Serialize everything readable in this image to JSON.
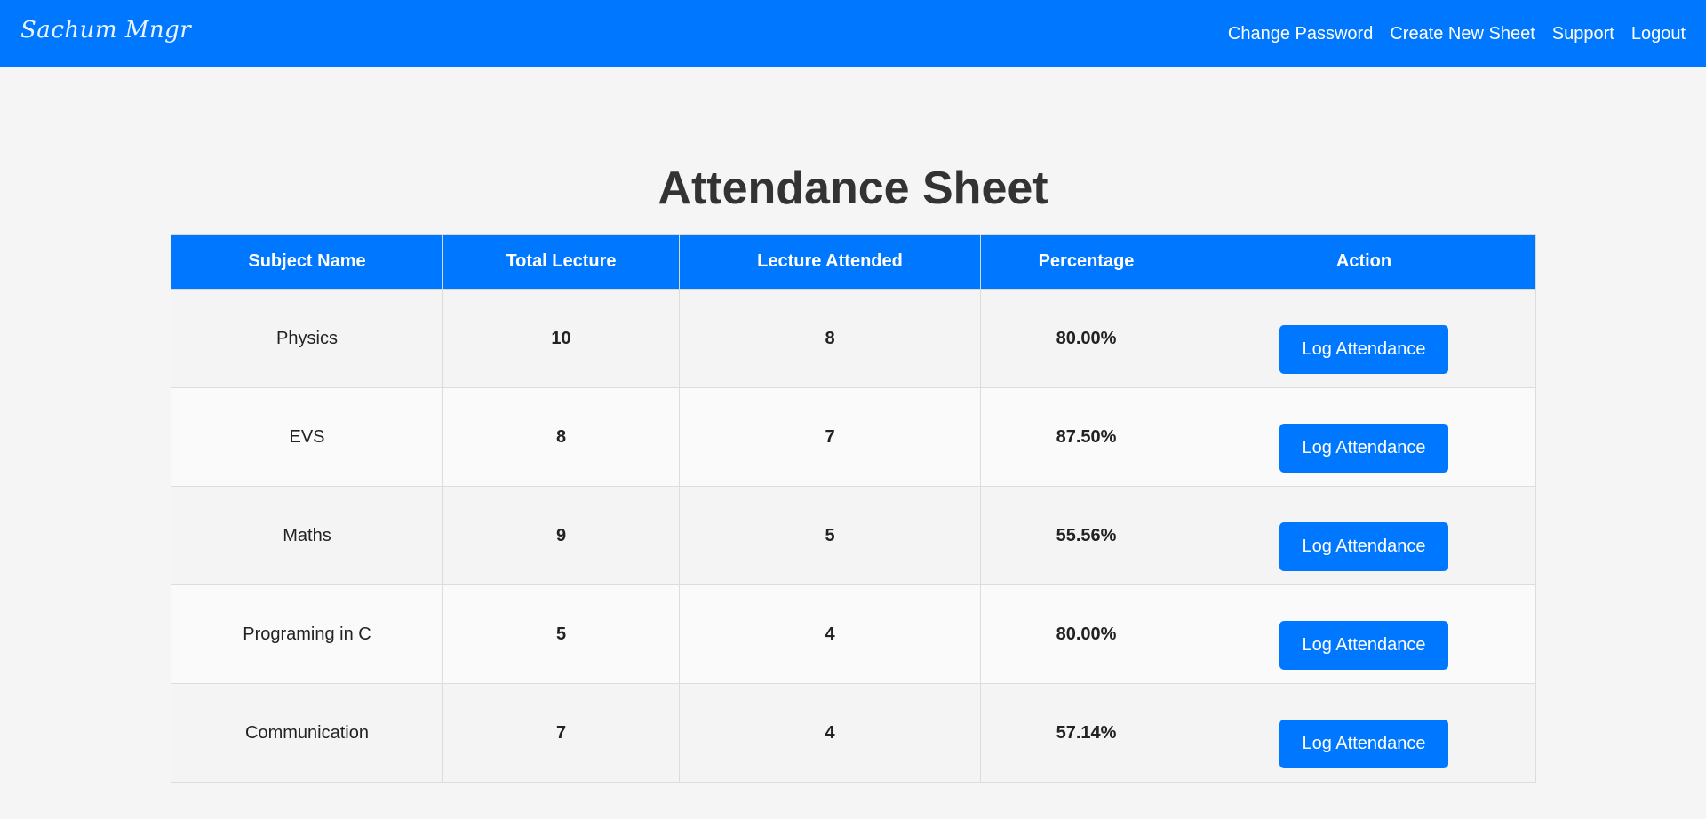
{
  "navbar": {
    "brand": "Sachum Mngr",
    "links": [
      "Change Password",
      "Create New Sheet",
      "Support",
      "Logout"
    ]
  },
  "main": {
    "title": "Attendance Sheet",
    "columns": [
      "Subject Name",
      "Total Lecture",
      "Lecture Attended",
      "Percentage",
      "Action"
    ],
    "rows": [
      {
        "subject": "Physics",
        "total": "10",
        "attended": "8",
        "percentage": "80.00%",
        "action": "Log Attendance"
      },
      {
        "subject": "EVS",
        "total": "8",
        "attended": "7",
        "percentage": "87.50%",
        "action": "Log Attendance"
      },
      {
        "subject": "Maths",
        "total": "9",
        "attended": "5",
        "percentage": "55.56%",
        "action": "Log Attendance"
      },
      {
        "subject": "Programing in C",
        "total": "5",
        "attended": "4",
        "percentage": "80.00%",
        "action": "Log Attendance"
      },
      {
        "subject": "Communication",
        "total": "7",
        "attended": "4",
        "percentage": "57.14%",
        "action": "Log Attendance"
      }
    ]
  },
  "colors": {
    "primary": "#0077ff",
    "background": "#f5f5f5",
    "text": "#333333"
  }
}
